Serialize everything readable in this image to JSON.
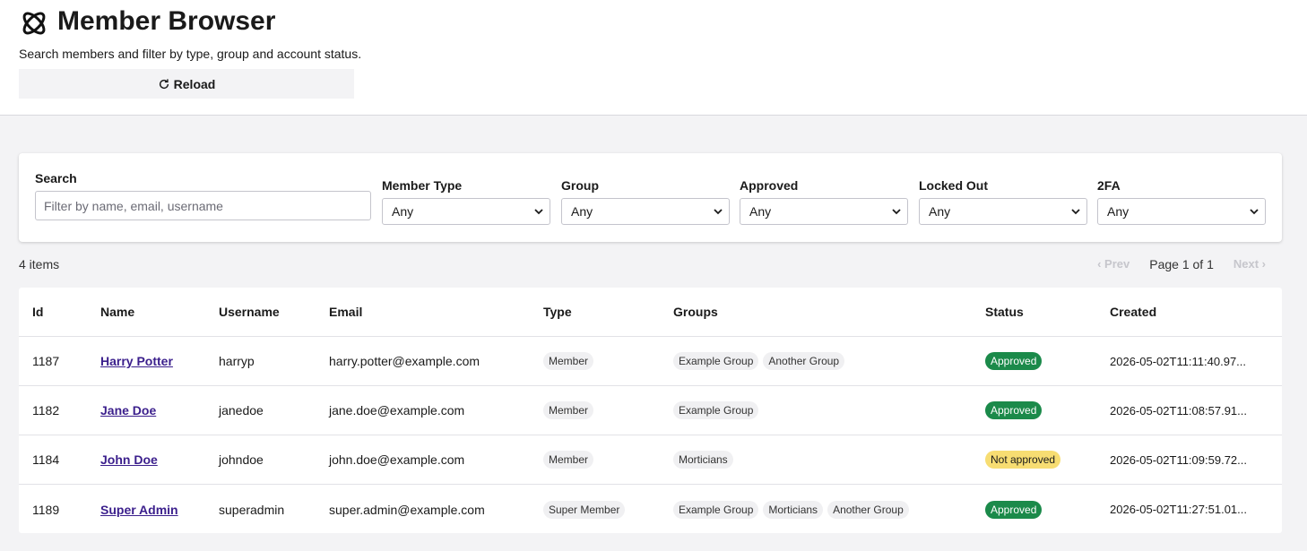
{
  "header": {
    "title": "Member Browser",
    "subtitle": "Search members and filter by type, group and account status.",
    "reload_label": "Reload"
  },
  "filters": {
    "search_label": "Search",
    "search_placeholder": "Filter by name, email, username",
    "search_value": "",
    "member_type": {
      "label": "Member Type",
      "value": "Any"
    },
    "group": {
      "label": "Group",
      "value": "Any"
    },
    "approved": {
      "label": "Approved",
      "value": "Any"
    },
    "locked_out": {
      "label": "Locked Out",
      "value": "Any"
    },
    "twofa": {
      "label": "2FA",
      "value": "Any"
    }
  },
  "results": {
    "count_text": "4 items",
    "prev_label": "‹ Prev",
    "page_text": "Page 1 of 1",
    "next_label": "Next ›"
  },
  "table": {
    "columns": [
      "Id",
      "Name",
      "Username",
      "Email",
      "Type",
      "Groups",
      "Status",
      "Created"
    ],
    "rows": [
      {
        "id": "1187",
        "name": "Harry Potter",
        "username": "harryp",
        "email": "harry.potter@example.com",
        "type": "Member",
        "groups": [
          "Example Group",
          "Another Group"
        ],
        "status": "Approved",
        "status_kind": "ok",
        "created": "2026-05-02T11:11:40.97..."
      },
      {
        "id": "1182",
        "name": "Jane Doe",
        "username": "janedoe",
        "email": "jane.doe@example.com",
        "type": "Member",
        "groups": [
          "Example Group"
        ],
        "status": "Approved",
        "status_kind": "ok",
        "created": "2026-05-02T11:08:57.91..."
      },
      {
        "id": "1184",
        "name": "John Doe",
        "username": "johndoe",
        "email": "john.doe@example.com",
        "type": "Member",
        "groups": [
          "Morticians"
        ],
        "status": "Not approved",
        "status_kind": "warn",
        "created": "2026-05-02T11:09:59.72..."
      },
      {
        "id": "1189",
        "name": "Super Admin",
        "username": "superadmin",
        "email": "super.admin@example.com",
        "type": "Super Member",
        "groups": [
          "Example Group",
          "Morticians",
          "Another Group"
        ],
        "status": "Approved",
        "status_kind": "ok",
        "created": "2026-05-02T11:27:51.01..."
      }
    ]
  },
  "colors": {
    "approved": "#1b8a4a",
    "not_approved": "#f7dd72",
    "link": "#3b1f8c"
  },
  "icons": {
    "logo": "atom-logo-icon",
    "reload": "refresh-icon",
    "select": "chevron-down-icon"
  }
}
